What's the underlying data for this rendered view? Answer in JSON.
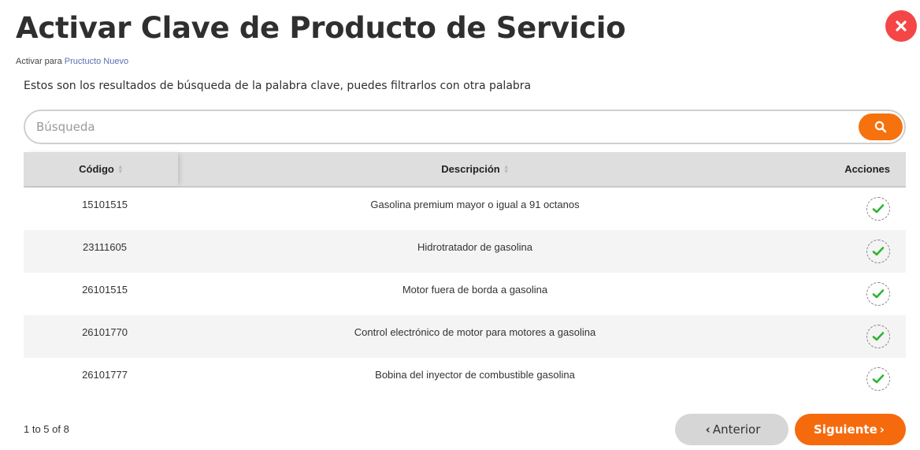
{
  "header": {
    "title": "Activar Clave de Producto de Servicio",
    "subtitle_prefix": "Activar para",
    "subtitle_link": "Pructucto Nuevo",
    "close_icon": "close-icon"
  },
  "intro_text": "Estos son los resultados de búsqueda de la palabra clave, puedes filtrarlos con otra palabra",
  "search": {
    "placeholder": "Búsqueda",
    "value": "",
    "button_icon": "search-icon"
  },
  "table": {
    "columns": {
      "code": "Código",
      "description": "Descripción",
      "actions": "Acciones"
    },
    "rows": [
      {
        "code": "15101515",
        "description": "Gasolina premium mayor o igual a 91 octanos"
      },
      {
        "code": "23111605",
        "description": "Hidrotratador de gasolina"
      },
      {
        "code": "26101515",
        "description": "Motor fuera de borda a gasolina"
      },
      {
        "code": "26101770",
        "description": "Control electrónico de motor para motores a gasolina"
      },
      {
        "code": "26101777",
        "description": "Bobina del inyector de combustible gasolina"
      }
    ]
  },
  "pagination": {
    "info": "1 to 5 of 8",
    "prev_label": "Anterior",
    "next_label": "Siguiente"
  },
  "colors": {
    "accent": "#f5720f",
    "close": "#f44646",
    "check": "#2db52d"
  }
}
